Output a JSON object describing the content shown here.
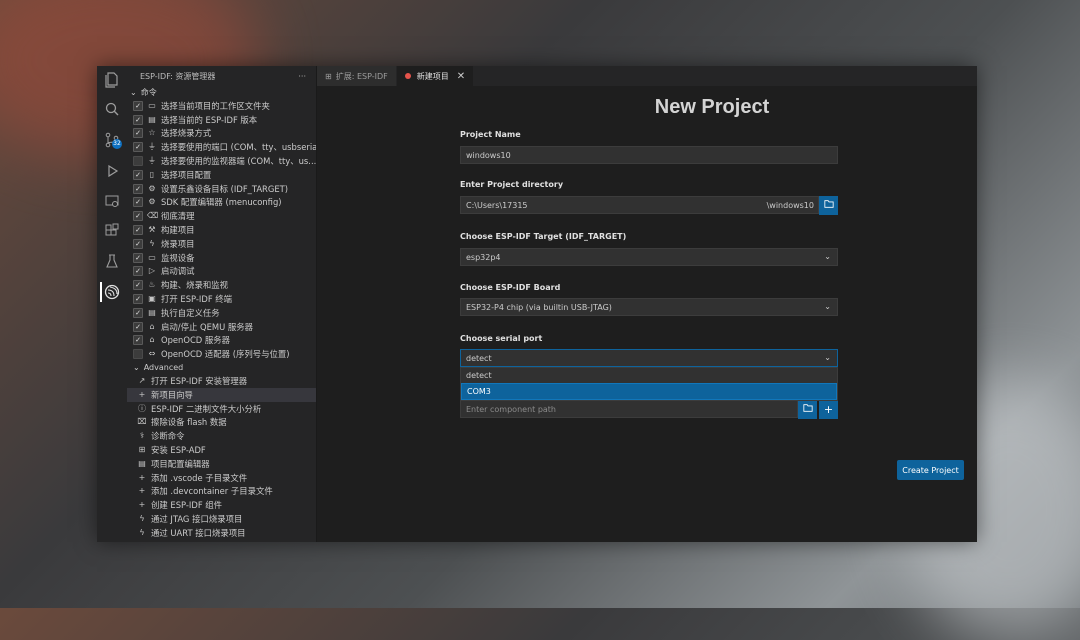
{
  "colors": {
    "accent": "#0e639c",
    "window_bg": "#1e1e1e",
    "sidebar_bg": "#252526"
  },
  "activity_bar": {
    "badge_count": "32"
  },
  "sidebar": {
    "title": "ESP-IDF: 资源管理器",
    "more": "···",
    "commands_section": "命令",
    "commands": [
      {
        "label": "选择当前项目的工作区文件夹",
        "checked": true,
        "icon": "folder-icon"
      },
      {
        "label": "选择当前的 ESP-IDF 版本",
        "checked": true,
        "icon": "version-icon"
      },
      {
        "label": "选择烧录方式",
        "checked": true,
        "icon": "star-icon"
      },
      {
        "label": "选择要使用的端口 (COM、tty、usbserial)",
        "checked": true,
        "icon": "plug-icon"
      },
      {
        "label": "选择要使用的监视器端 (COM、tty、us...",
        "checked": false,
        "icon": "plug-icon"
      },
      {
        "label": "选择项目配置",
        "checked": true,
        "icon": "file-icon"
      },
      {
        "label": "设置乐鑫设备目标 (IDF_TARGET)",
        "checked": true,
        "icon": "chip-icon"
      },
      {
        "label": "SDK 配置编辑器 (menuconfig)",
        "checked": true,
        "icon": "gear-icon"
      },
      {
        "label": "彻底清理",
        "checked": true,
        "icon": "trash-icon"
      },
      {
        "label": "构建项目",
        "checked": true,
        "icon": "wrench-icon"
      },
      {
        "label": "烧录项目",
        "checked": true,
        "icon": "flash-icon"
      },
      {
        "label": "监视设备",
        "checked": true,
        "icon": "monitor-icon"
      },
      {
        "label": "启动调试",
        "checked": true,
        "icon": "debug-icon"
      },
      {
        "label": "构建、烧录和监视",
        "checked": true,
        "icon": "flame-icon"
      },
      {
        "label": "打开 ESP-IDF 终端",
        "checked": true,
        "icon": "terminal-icon"
      },
      {
        "label": "执行自定义任务",
        "checked": true,
        "icon": "task-icon"
      },
      {
        "label": "启动/停止 QEMU 服务器",
        "checked": true,
        "icon": "server-icon"
      },
      {
        "label": "OpenOCD 服务器",
        "checked": true,
        "icon": "server-icon"
      },
      {
        "label": "OpenOCD 适配器 (序列号与位置)",
        "checked": false,
        "icon": "link-icon"
      }
    ],
    "advanced_section": "Advanced",
    "advanced": [
      {
        "label": "打开 ESP-IDF 安装管理器",
        "icon": "external-icon"
      },
      {
        "label": "新项目向导",
        "icon": "plus-icon"
      },
      {
        "label": "ESP-IDF 二进制文件大小分析",
        "icon": "info-icon"
      },
      {
        "label": "擦除设备 flash 数据",
        "icon": "erase-icon"
      },
      {
        "label": "诊断命令",
        "icon": "diagnose-icon"
      },
      {
        "label": "安装 ESP-ADF",
        "icon": "package-icon"
      },
      {
        "label": "项目配置编辑器",
        "icon": "editor-icon"
      },
      {
        "label": "添加 .vscode 子目录文件",
        "icon": "plus-icon"
      },
      {
        "label": "添加 .devcontainer 子目录文件",
        "icon": "plus-icon"
      },
      {
        "label": "创建 ESP-IDF 组件",
        "icon": "plus-icon"
      },
      {
        "label": "通过 JTAG 接口烧录项目",
        "icon": "flash-icon"
      },
      {
        "label": "通过 UART 接口烧录项目",
        "icon": "flash-icon"
      }
    ]
  },
  "tabs": [
    {
      "label": "扩展: ESP-IDF",
      "active": false
    },
    {
      "label": "新建项目",
      "active": true,
      "close": "✕"
    }
  ],
  "form": {
    "title": "New Project",
    "project_name_label": "Project Name",
    "project_name_value": "windows10",
    "directory_label": "Enter Project directory",
    "directory_value": "C:\\Users\\17315",
    "directory_suffix": "\\windows10",
    "target_label": "Choose ESP-IDF Target (IDF_TARGET)",
    "target_value": "esp32p4",
    "board_label": "Choose ESP-IDF Board",
    "board_value": "ESP32-P4 chip (via builtin USB-JTAG)",
    "serial_label": "Choose serial port",
    "serial_value": "detect",
    "serial_options": [
      "detect",
      "COM3"
    ],
    "component_placeholder": "Enter component path",
    "create_label": "Create Project"
  }
}
